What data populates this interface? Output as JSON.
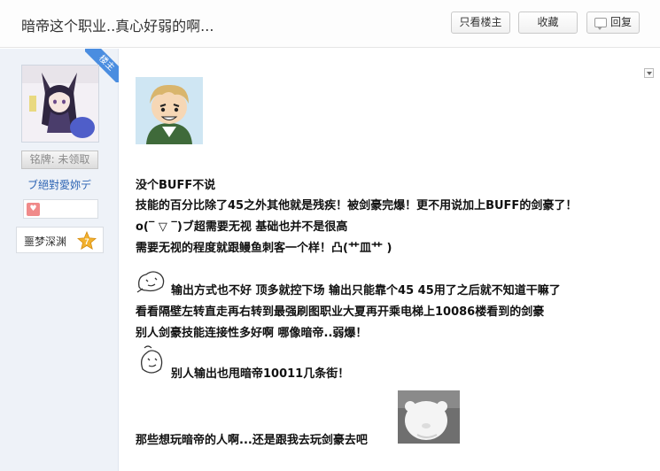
{
  "header": {
    "title": "暗帝这个职业..真心好弱的啊...",
    "btn_only_author": "只看楼主",
    "btn_favorite": "收藏",
    "btn_reply": "回复"
  },
  "author": {
    "corner_tag": "楼主",
    "badge": "铭牌: 未领取",
    "username": "ブ絕對愛妳デ",
    "fan_name": "噩梦深渊",
    "fan_level": "7"
  },
  "post": {
    "lines": [
      "没个BUFF不说",
      "技能的百分比除了45之外其他就是残疾！被剑豪完爆！更不用说加上BUFF的剑豪了！",
      "o(‾ ▽ ‾)ブ超需要无视 基础也并不是很高",
      "需要无视的程度就跟鳗鱼刺客一个样！凸(艹皿艹 )",
      "输出方式也不好 顶多就控下场 输出只能靠个45 45用了之后就不知道干嘛了",
      "看看隔壁左转直走再右转到最强刷图职业大夏再开乘电梯上10086楼看到的剑豪",
      "别人剑豪技能连接性多好啊 哪像暗帝..弱爆！",
      "别人输出也甩暗帝10011几条街！",
      "那些想玩暗帝的人啊...还是跟我去玩剑豪去吧"
    ]
  },
  "colors": {
    "accent_blue": "#4a8de0",
    "link_blue": "#2d64b3",
    "sidebar_bg": "#eef2f8"
  }
}
